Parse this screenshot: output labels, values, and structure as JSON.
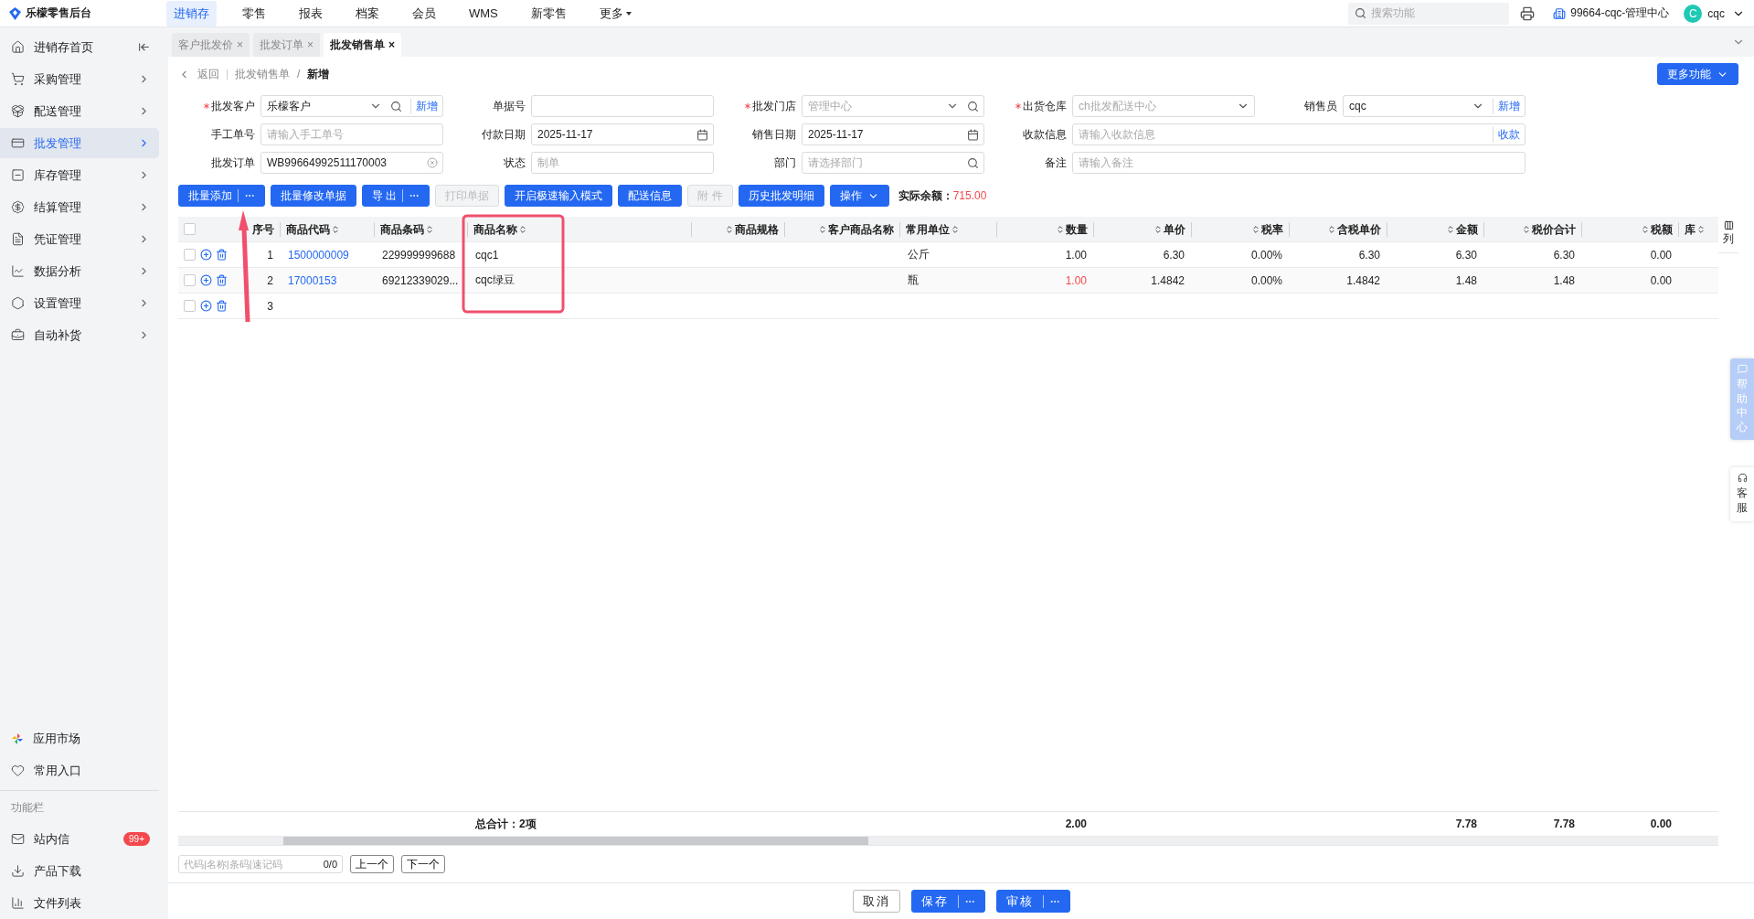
{
  "app": {
    "title": "乐檬零售后台"
  },
  "top_nav": [
    {
      "label": "进销存",
      "selected": true,
      "kind": "link"
    },
    {
      "label": "零售",
      "selected": false,
      "kind": "link"
    },
    {
      "label": "报表",
      "selected": false,
      "kind": "link"
    },
    {
      "label": "档案",
      "selected": false,
      "kind": "link"
    },
    {
      "label": "会员",
      "selected": false,
      "kind": "link"
    },
    {
      "label": "WMS",
      "selected": false,
      "kind": "link"
    },
    {
      "label": "新零售",
      "selected": false,
      "kind": "link"
    },
    {
      "label": "更多",
      "selected": false,
      "kind": "dropdown"
    }
  ],
  "search": {
    "placeholder": "搜索功能"
  },
  "org": "99664-cqc-管理中心",
  "user": {
    "avatar": "C",
    "name": "cqc"
  },
  "sidebar": {
    "items": [
      {
        "label": "进销存首页",
        "selected": false,
        "kind": "home"
      },
      {
        "label": "采购管理",
        "selected": false,
        "kind": "cart"
      },
      {
        "label": "配送管理",
        "selected": false,
        "kind": "box"
      },
      {
        "label": "批发管理",
        "selected": true,
        "kind": "card"
      },
      {
        "label": "库存管理",
        "selected": false,
        "kind": "stock"
      },
      {
        "label": "结算管理",
        "selected": false,
        "kind": "money"
      },
      {
        "label": "凭证管理",
        "selected": false,
        "kind": "doc"
      },
      {
        "label": "数据分析",
        "selected": false,
        "kind": "chart"
      },
      {
        "label": "设置管理",
        "selected": false,
        "kind": "settings"
      },
      {
        "label": "自动补货",
        "selected": false,
        "kind": "bag"
      }
    ],
    "links": [
      {
        "label": "应用市场",
        "kind": "apps"
      },
      {
        "label": "常用入口",
        "kind": "heart"
      }
    ],
    "section_label": "功能栏",
    "tools": [
      {
        "label": "站内信",
        "kind": "mail",
        "badge": "99+"
      },
      {
        "label": "产品下载",
        "kind": "download"
      },
      {
        "label": "文件列表",
        "kind": "bars"
      }
    ]
  },
  "tabs": [
    {
      "label": "客户批发价",
      "selected": false,
      "close": "×"
    },
    {
      "label": "批发订单",
      "selected": false,
      "close": "×"
    },
    {
      "label": "批发销售单",
      "selected": true,
      "close": "×"
    }
  ],
  "breadcrumb": {
    "back": "返回",
    "path": [
      "批发销售单",
      "新增"
    ],
    "separator": "/"
  },
  "more_button": "更多功能",
  "form": [
    {
      "label": "批发客户",
      "required": true,
      "kind": "select-search",
      "value": "乐檬客户",
      "action": "新增"
    },
    {
      "label": "单据号",
      "required": false,
      "kind": "input"
    },
    {
      "label": "批发门店",
      "required": true,
      "kind": "select-search",
      "placeholder": "管理中心"
    },
    {
      "label": "出货仓库",
      "required": true,
      "kind": "select",
      "placeholder": "ch批发配送中心"
    },
    {
      "label": "销售员",
      "required": false,
      "kind": "select",
      "value": "cqc",
      "action": "新增"
    },
    {
      "label": "手工单号",
      "required": false,
      "kind": "input",
      "placeholder": "请输入手工单号"
    },
    {
      "label": "付款日期",
      "required": false,
      "kind": "date",
      "value": "2025-11-17"
    },
    {
      "label": "销售日期",
      "required": false,
      "kind": "date",
      "value": "2025-11-17"
    },
    {
      "label": "收款信息",
      "required": false,
      "kind": "wide",
      "placeholder": "请输入收款信息",
      "action": "收款"
    },
    {
      "label": "批发订单",
      "required": false,
      "kind": "clearable",
      "value": "WB99664992511170003"
    },
    {
      "label": "状态",
      "required": false,
      "kind": "input",
      "placeholder": "制单"
    },
    {
      "label": "部门",
      "required": false,
      "kind": "search",
      "placeholder": "请选择部门"
    },
    {
      "label": "备注",
      "required": false,
      "kind": "wide",
      "placeholder": "请输入备注"
    }
  ],
  "toolbar": [
    {
      "label": "批量添加",
      "kind": "split",
      "disabled": false
    },
    {
      "label": "批量修改单据",
      "kind": "plain",
      "disabled": false
    },
    {
      "label": "导 出",
      "kind": "split",
      "disabled": false
    },
    {
      "label": "打印单据",
      "kind": "plain",
      "disabled": true
    },
    {
      "label": "开启极速输入模式",
      "kind": "plain",
      "disabled": false
    },
    {
      "label": "配送信息",
      "kind": "plain",
      "disabled": false
    },
    {
      "label": "附 件",
      "kind": "plain",
      "disabled": true
    },
    {
      "label": "历史批发明细",
      "kind": "plain",
      "disabled": false
    },
    {
      "label": "操作",
      "kind": "dropdown",
      "disabled": false
    }
  ],
  "balance": {
    "label": "实际余额：",
    "value": "715.00"
  },
  "table": {
    "select_all": {
      "checked": false
    },
    "columns": [
      {
        "label": "序号"
      },
      {
        "label": "商品代码",
        "sortable": true
      },
      {
        "label": "商品条码",
        "sortable": true
      },
      {
        "label": "商品名称",
        "sortable": true
      },
      {
        "label": "商品规格",
        "sortable": true
      },
      {
        "label": "客户商品名称",
        "sortable": true
      },
      {
        "label": "常用单位",
        "sortable": true
      },
      {
        "label": "数量",
        "sortable": true
      },
      {
        "label": "单价",
        "sortable": true
      },
      {
        "label": "税率",
        "sortable": true
      },
      {
        "label": "含税单价",
        "sortable": true
      },
      {
        "label": "金额",
        "sortable": true
      },
      {
        "label": "税价合计",
        "sortable": true
      },
      {
        "label": "税额",
        "sortable": true
      },
      {
        "label": "库",
        "sortable": true
      }
    ],
    "rows": [
      {
        "checked": false,
        "qty_alert": false,
        "seq": "1",
        "code": "1500000009",
        "barcode": "229999999688",
        "name": "cqc1",
        "unit": "公斤",
        "qty": "1.00",
        "price": "6.30",
        "tax_rate": "0.00%",
        "tax_price": "6.30",
        "amount": "6.30",
        "total": "6.30",
        "tax": "0.00"
      },
      {
        "checked": false,
        "qty_alert": true,
        "seq": "2",
        "code": "17000153",
        "barcode": "69212339029...",
        "name": "cqc绿豆",
        "unit": "瓶",
        "qty": "1.00",
        "price": "1.4842",
        "tax_rate": "0.00%",
        "tax_price": "1.4842",
        "amount": "1.48",
        "total": "1.48",
        "tax": "0.00"
      },
      {
        "checked": false,
        "seq": "3"
      }
    ],
    "totals": {
      "label": "总合计：2项",
      "qty": "2.00",
      "amount": "7.78",
      "total": "7.78",
      "tax": "0.00"
    },
    "settings_label": "列"
  },
  "finder": {
    "placeholder": "代码|名称|条码|速记码",
    "count": "0/0",
    "prev": "上一个",
    "next": "下一个"
  },
  "footer": [
    {
      "label": "取消",
      "kind": "plain"
    },
    {
      "label": "保存",
      "kind": "split"
    },
    {
      "label": "审核",
      "kind": "split"
    }
  ],
  "float_tabs": [
    {
      "label": "帮助中心",
      "kind": "help"
    },
    {
      "label": "客服",
      "kind": "service"
    }
  ],
  "annotations": {
    "highlight_box": true,
    "arrow": true
  }
}
